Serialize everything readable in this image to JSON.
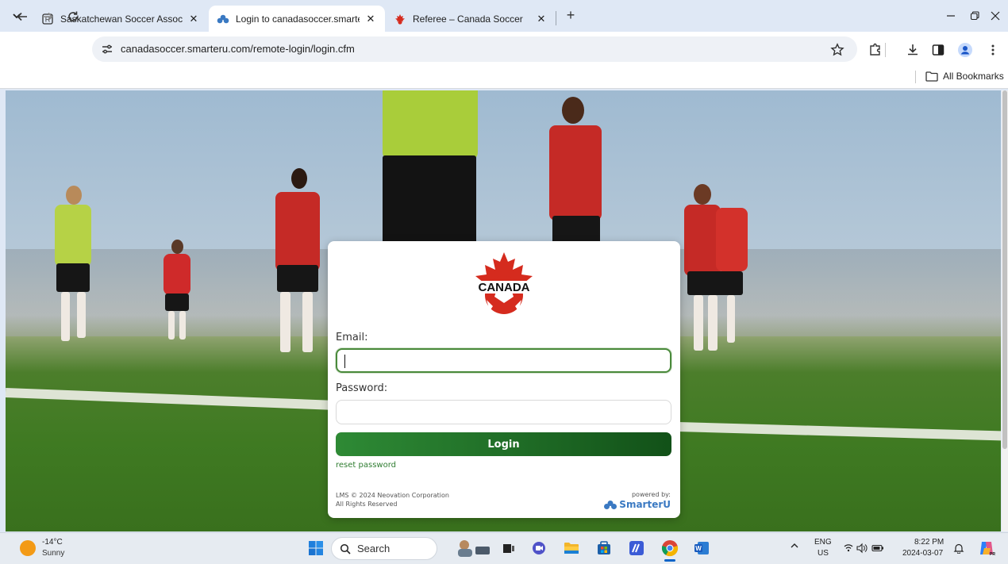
{
  "browser": {
    "tabs": [
      {
        "title": "Saskatchewan Soccer Associatio",
        "icon": "r-square-icon",
        "active": false
      },
      {
        "title": "Login to canadasoccer.smarteru.",
        "icon": "smarteru-icon",
        "active": true
      },
      {
        "title": "Referee – Canada Soccer",
        "icon": "canada-soccer-icon",
        "active": false
      }
    ],
    "url": "canadasoccer.smarteru.com/remote-login/login.cfm",
    "bookmarks_label": "All Bookmarks"
  },
  "login": {
    "logo_text": "CANADA",
    "email_label": "Email:",
    "email_value": "",
    "password_label": "Password:",
    "password_value": "",
    "login_button": "Login",
    "reset_link": "reset password",
    "footer_line1": "LMS © 2024 Neovation Corporation",
    "footer_line2": "All Rights Reserved",
    "powered_by": "powered by:",
    "brand": "SmarterU"
  },
  "taskbar": {
    "weather_temp": "-14°C",
    "weather_desc": "Sunny",
    "search_placeholder": "Search",
    "lang_top": "ENG",
    "lang_bottom": "US",
    "time": "8:22 PM",
    "date": "2024-03-07"
  },
  "colors": {
    "accent_green": "#1f6c26",
    "canada_red": "#d52b1e",
    "chrome_bg": "#dfe8f5"
  }
}
